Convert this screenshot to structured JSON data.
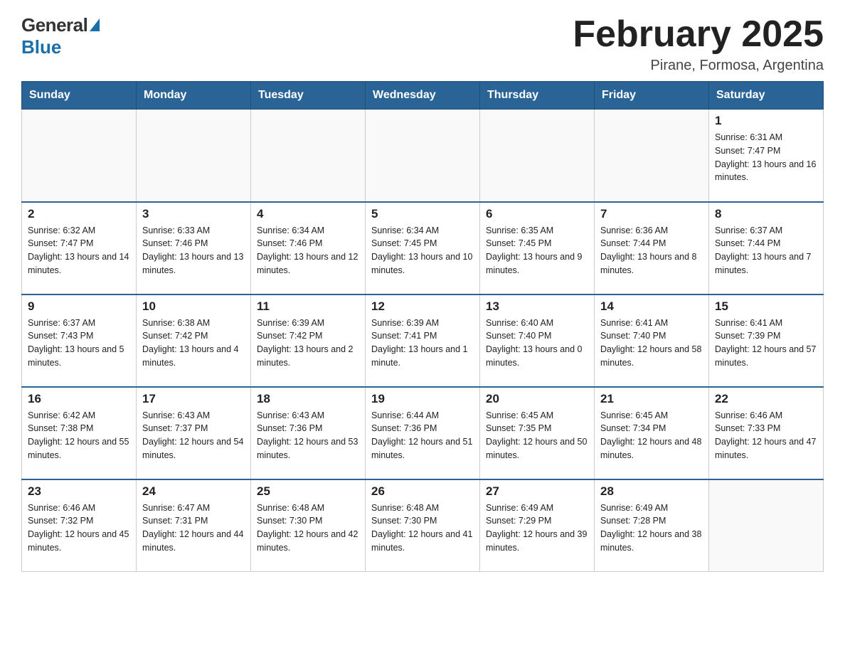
{
  "header": {
    "logo_general": "General",
    "logo_blue": "Blue",
    "month_title": "February 2025",
    "location": "Pirane, Formosa, Argentina"
  },
  "weekdays": [
    "Sunday",
    "Monday",
    "Tuesday",
    "Wednesday",
    "Thursday",
    "Friday",
    "Saturday"
  ],
  "weeks": [
    [
      {
        "day": "",
        "info": ""
      },
      {
        "day": "",
        "info": ""
      },
      {
        "day": "",
        "info": ""
      },
      {
        "day": "",
        "info": ""
      },
      {
        "day": "",
        "info": ""
      },
      {
        "day": "",
        "info": ""
      },
      {
        "day": "1",
        "info": "Sunrise: 6:31 AM\nSunset: 7:47 PM\nDaylight: 13 hours and 16 minutes."
      }
    ],
    [
      {
        "day": "2",
        "info": "Sunrise: 6:32 AM\nSunset: 7:47 PM\nDaylight: 13 hours and 14 minutes."
      },
      {
        "day": "3",
        "info": "Sunrise: 6:33 AM\nSunset: 7:46 PM\nDaylight: 13 hours and 13 minutes."
      },
      {
        "day": "4",
        "info": "Sunrise: 6:34 AM\nSunset: 7:46 PM\nDaylight: 13 hours and 12 minutes."
      },
      {
        "day": "5",
        "info": "Sunrise: 6:34 AM\nSunset: 7:45 PM\nDaylight: 13 hours and 10 minutes."
      },
      {
        "day": "6",
        "info": "Sunrise: 6:35 AM\nSunset: 7:45 PM\nDaylight: 13 hours and 9 minutes."
      },
      {
        "day": "7",
        "info": "Sunrise: 6:36 AM\nSunset: 7:44 PM\nDaylight: 13 hours and 8 minutes."
      },
      {
        "day": "8",
        "info": "Sunrise: 6:37 AM\nSunset: 7:44 PM\nDaylight: 13 hours and 7 minutes."
      }
    ],
    [
      {
        "day": "9",
        "info": "Sunrise: 6:37 AM\nSunset: 7:43 PM\nDaylight: 13 hours and 5 minutes."
      },
      {
        "day": "10",
        "info": "Sunrise: 6:38 AM\nSunset: 7:42 PM\nDaylight: 13 hours and 4 minutes."
      },
      {
        "day": "11",
        "info": "Sunrise: 6:39 AM\nSunset: 7:42 PM\nDaylight: 13 hours and 2 minutes."
      },
      {
        "day": "12",
        "info": "Sunrise: 6:39 AM\nSunset: 7:41 PM\nDaylight: 13 hours and 1 minute."
      },
      {
        "day": "13",
        "info": "Sunrise: 6:40 AM\nSunset: 7:40 PM\nDaylight: 13 hours and 0 minutes."
      },
      {
        "day": "14",
        "info": "Sunrise: 6:41 AM\nSunset: 7:40 PM\nDaylight: 12 hours and 58 minutes."
      },
      {
        "day": "15",
        "info": "Sunrise: 6:41 AM\nSunset: 7:39 PM\nDaylight: 12 hours and 57 minutes."
      }
    ],
    [
      {
        "day": "16",
        "info": "Sunrise: 6:42 AM\nSunset: 7:38 PM\nDaylight: 12 hours and 55 minutes."
      },
      {
        "day": "17",
        "info": "Sunrise: 6:43 AM\nSunset: 7:37 PM\nDaylight: 12 hours and 54 minutes."
      },
      {
        "day": "18",
        "info": "Sunrise: 6:43 AM\nSunset: 7:36 PM\nDaylight: 12 hours and 53 minutes."
      },
      {
        "day": "19",
        "info": "Sunrise: 6:44 AM\nSunset: 7:36 PM\nDaylight: 12 hours and 51 minutes."
      },
      {
        "day": "20",
        "info": "Sunrise: 6:45 AM\nSunset: 7:35 PM\nDaylight: 12 hours and 50 minutes."
      },
      {
        "day": "21",
        "info": "Sunrise: 6:45 AM\nSunset: 7:34 PM\nDaylight: 12 hours and 48 minutes."
      },
      {
        "day": "22",
        "info": "Sunrise: 6:46 AM\nSunset: 7:33 PM\nDaylight: 12 hours and 47 minutes."
      }
    ],
    [
      {
        "day": "23",
        "info": "Sunrise: 6:46 AM\nSunset: 7:32 PM\nDaylight: 12 hours and 45 minutes."
      },
      {
        "day": "24",
        "info": "Sunrise: 6:47 AM\nSunset: 7:31 PM\nDaylight: 12 hours and 44 minutes."
      },
      {
        "day": "25",
        "info": "Sunrise: 6:48 AM\nSunset: 7:30 PM\nDaylight: 12 hours and 42 minutes."
      },
      {
        "day": "26",
        "info": "Sunrise: 6:48 AM\nSunset: 7:30 PM\nDaylight: 12 hours and 41 minutes."
      },
      {
        "day": "27",
        "info": "Sunrise: 6:49 AM\nSunset: 7:29 PM\nDaylight: 12 hours and 39 minutes."
      },
      {
        "day": "28",
        "info": "Sunrise: 6:49 AM\nSunset: 7:28 PM\nDaylight: 12 hours and 38 minutes."
      },
      {
        "day": "",
        "info": ""
      }
    ]
  ]
}
